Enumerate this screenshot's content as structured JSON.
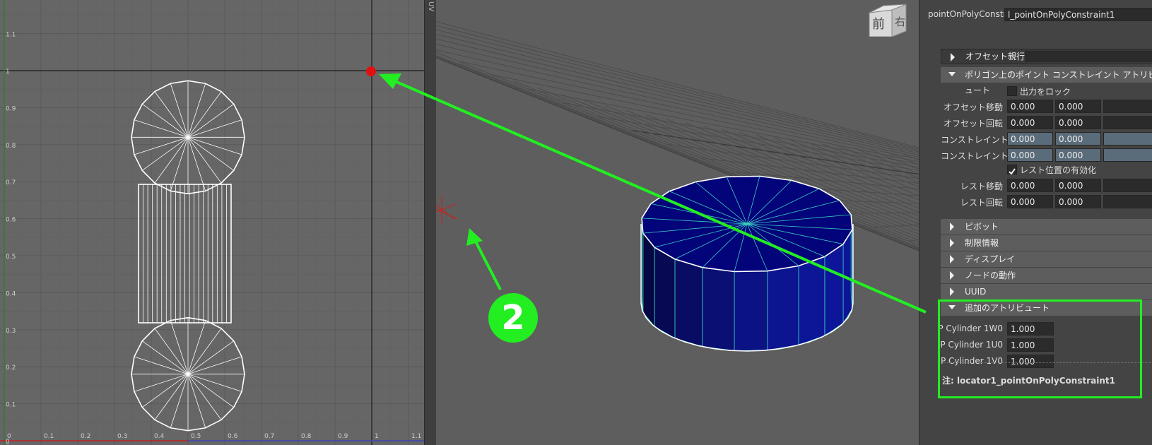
{
  "uv_editor": {
    "tick_labels_x": [
      "0",
      "0.1",
      "0.2",
      "0.3",
      "0.4",
      "0.5",
      "0.6",
      "0.7",
      "0.8",
      "0.9",
      "1",
      "1.1"
    ],
    "tick_labels_y": [
      "1.1",
      "1",
      "0.9",
      "0.8",
      "0.7",
      "0.6",
      "0.5",
      "0.4",
      "0.3",
      "0.2",
      "0.1",
      "0"
    ],
    "point_color": "#e01010"
  },
  "divider": {
    "label": "UV"
  },
  "viewcube": {
    "front": "前",
    "right": "右"
  },
  "attribute_editor": {
    "node_label": "pointOnPolyConstraint:",
    "node_value": "l_pointOnPolyConstraint1",
    "offset_parent": "オフセット親行列",
    "section_main": "ポリゴン上のポイント コンストレイント アトリビュート",
    "lock_output": "出力をロック",
    "rows": [
      {
        "label": "オフセット移動",
        "values": [
          "0.000",
          "0.000"
        ]
      },
      {
        "label": "オフセット回転",
        "values": [
          "0.000",
          "0.000"
        ]
      },
      {
        "label": "コンストレイント移動",
        "values": [
          "0.000",
          "0.000"
        ]
      },
      {
        "label": "コンストレイント回転",
        "values": [
          "0.000",
          "0.000"
        ]
      },
      {
        "label": "レスト移動",
        "values": [
          "0.000",
          "0.000"
        ]
      },
      {
        "label": "レスト回転",
        "values": [
          "0.000",
          "0.000"
        ]
      }
    ],
    "enable_rest": "レスト位置の有効化",
    "sections": [
      "ピボット",
      "制限情報",
      "ディスプレイ",
      "ノードの動作",
      "UUID"
    ],
    "extra_section": "追加のアトリビュート",
    "extra_rows": [
      {
        "label": "P Cylinder 1W0",
        "value": "1.000"
      },
      {
        "label": "P Cylinder 1U0",
        "value": "1.000"
      },
      {
        "label": "P Cylinder 1V0",
        "value": "1.000"
      }
    ],
    "note": "注:  locator1_pointOnPolyConstraint1"
  },
  "annotation": {
    "badge": "2",
    "color": "#22ee22"
  }
}
